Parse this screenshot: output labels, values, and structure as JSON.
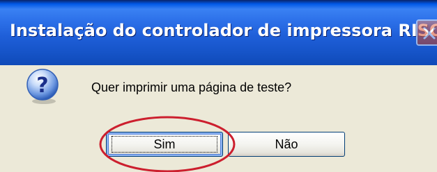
{
  "window": {
    "title": "Instalação do controlador de impressora RISO"
  },
  "dialog": {
    "icon": "question-icon",
    "message": "Quer imprimir uma página de teste?"
  },
  "buttons": {
    "yes_label": "Sim",
    "no_label": "Não"
  },
  "annotation": {
    "highlight": "Sim",
    "color": "#CC1F2E"
  },
  "colors": {
    "titlebar_blue": "#1F5FD9",
    "dialog_bg": "#ECE9D8",
    "button_border": "#003C74"
  }
}
